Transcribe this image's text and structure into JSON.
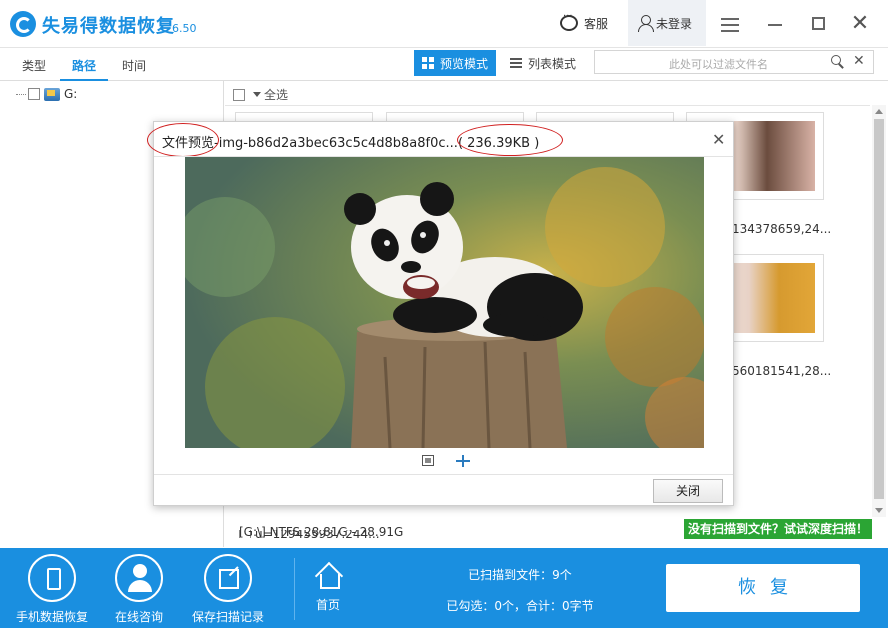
{
  "app": {
    "title": "失易得数据恢复",
    "version": "6.50",
    "service_label": "客服",
    "login_label": "未登录"
  },
  "toolbar": {
    "tabs": [
      "类型",
      "路径",
      "时间"
    ],
    "active_tab": "路径",
    "preview_mode_label": "预览模式",
    "list_mode_label": "列表模式",
    "filter_placeholder": "此处可以过滤文件名"
  },
  "tree": {
    "drive_label": "G:"
  },
  "main": {
    "select_all_label": "全选",
    "thumb_labels": [
      "134378659,24...",
      "560181541,28..."
    ],
    "partial_row_label": "u=129455937,244...",
    "status_text": "[G:\\] NTFS 28.81G - 28.91G",
    "deep_scan_label": "没有扫描到文件？试试深度扫描！"
  },
  "dialog": {
    "title_prefix": "文件预览",
    "title_name": "-img-b86d2a3bec63c5c4d8b8a8f0c...",
    "title_size": "( 236.39KB )",
    "close_button_label": "关闭"
  },
  "bottom": {
    "phone_recovery_label": "手机数据恢复",
    "online_consult_label": "在线咨询",
    "save_scan_label": "保存扫描记录",
    "home_label": "首页",
    "scanned_files": "已扫描到文件：9个",
    "selected_summary": "已勾选：0个，合计：0字节",
    "recover_label": "恢复"
  },
  "colors": {
    "accent": "#1a8fe0",
    "deep_scan_green": "#2ba534",
    "annotation_red": "#d02020"
  }
}
